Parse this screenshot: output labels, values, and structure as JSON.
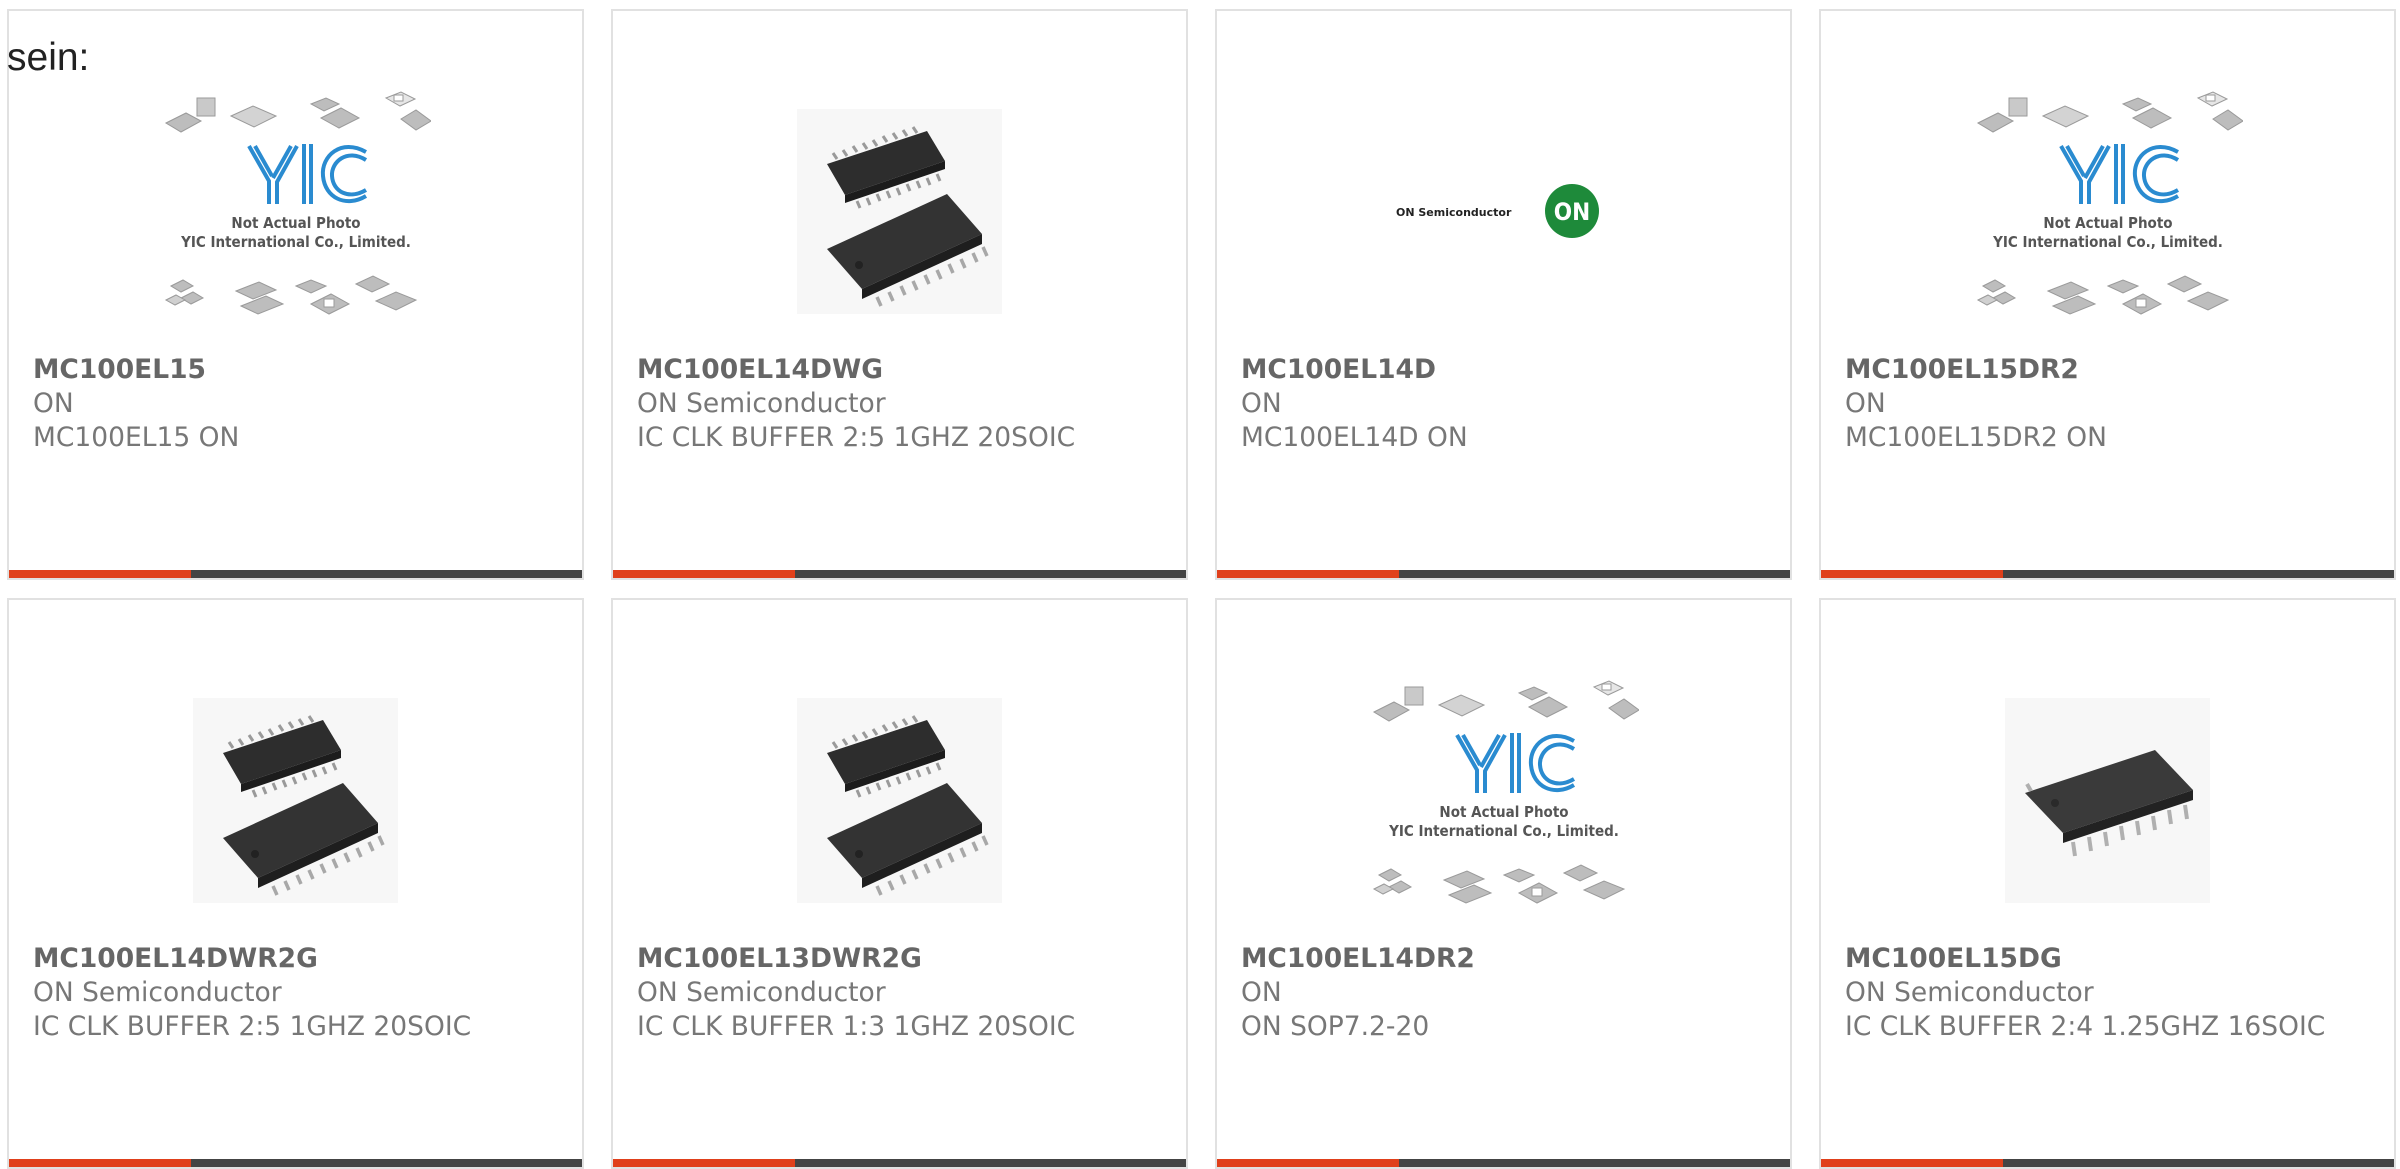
{
  "intro_text": "sein:",
  "colors": {
    "accent": "#e0401b",
    "bar": "#444444",
    "text": "#777777",
    "logo_blue": "#2a8bd0",
    "on_green": "#1e8a3a"
  },
  "placeholder": {
    "line1": "Not Actual Photo",
    "line2": "YIC International Co., Limited.",
    "logo": "YIC"
  },
  "brand_logo": {
    "text": "ON Semiconductor",
    "badge": "ON"
  },
  "products": [
    {
      "part": "MC100EL15",
      "maker": "ON",
      "desc": "MC100EL15 ON",
      "image": "yic-placeholder-icon"
    },
    {
      "part": "MC100EL14DWG",
      "maker": "ON Semiconductor",
      "desc": "IC CLK BUFFER 2:5 1GHZ 20SOIC",
      "image": "soic-two-chips-icon"
    },
    {
      "part": "MC100EL14D",
      "maker": "ON",
      "desc": "MC100EL14D ON",
      "image": "on-semiconductor-logo"
    },
    {
      "part": "MC100EL15DR2",
      "maker": "ON",
      "desc": "MC100EL15DR2 ON",
      "image": "yic-placeholder-icon"
    },
    {
      "part": "MC100EL14DWR2G",
      "maker": "ON Semiconductor",
      "desc": "IC CLK BUFFER 2:5 1GHZ 20SOIC",
      "image": "soic-two-chips-icon"
    },
    {
      "part": "MC100EL13DWR2G",
      "maker": "ON Semiconductor",
      "desc": "IC CLK BUFFER 1:3 1GHZ 20SOIC",
      "image": "soic-two-chips-icon"
    },
    {
      "part": "MC100EL14DR2",
      "maker": "ON",
      "desc": "ON SOP7.2-20",
      "image": "yic-placeholder-icon"
    },
    {
      "part": "MC100EL15DG",
      "maker": "ON Semiconductor",
      "desc": "IC CLK BUFFER 2:4 1.25GHZ 16SOIC",
      "image": "soic-single-chip-icon"
    }
  ]
}
